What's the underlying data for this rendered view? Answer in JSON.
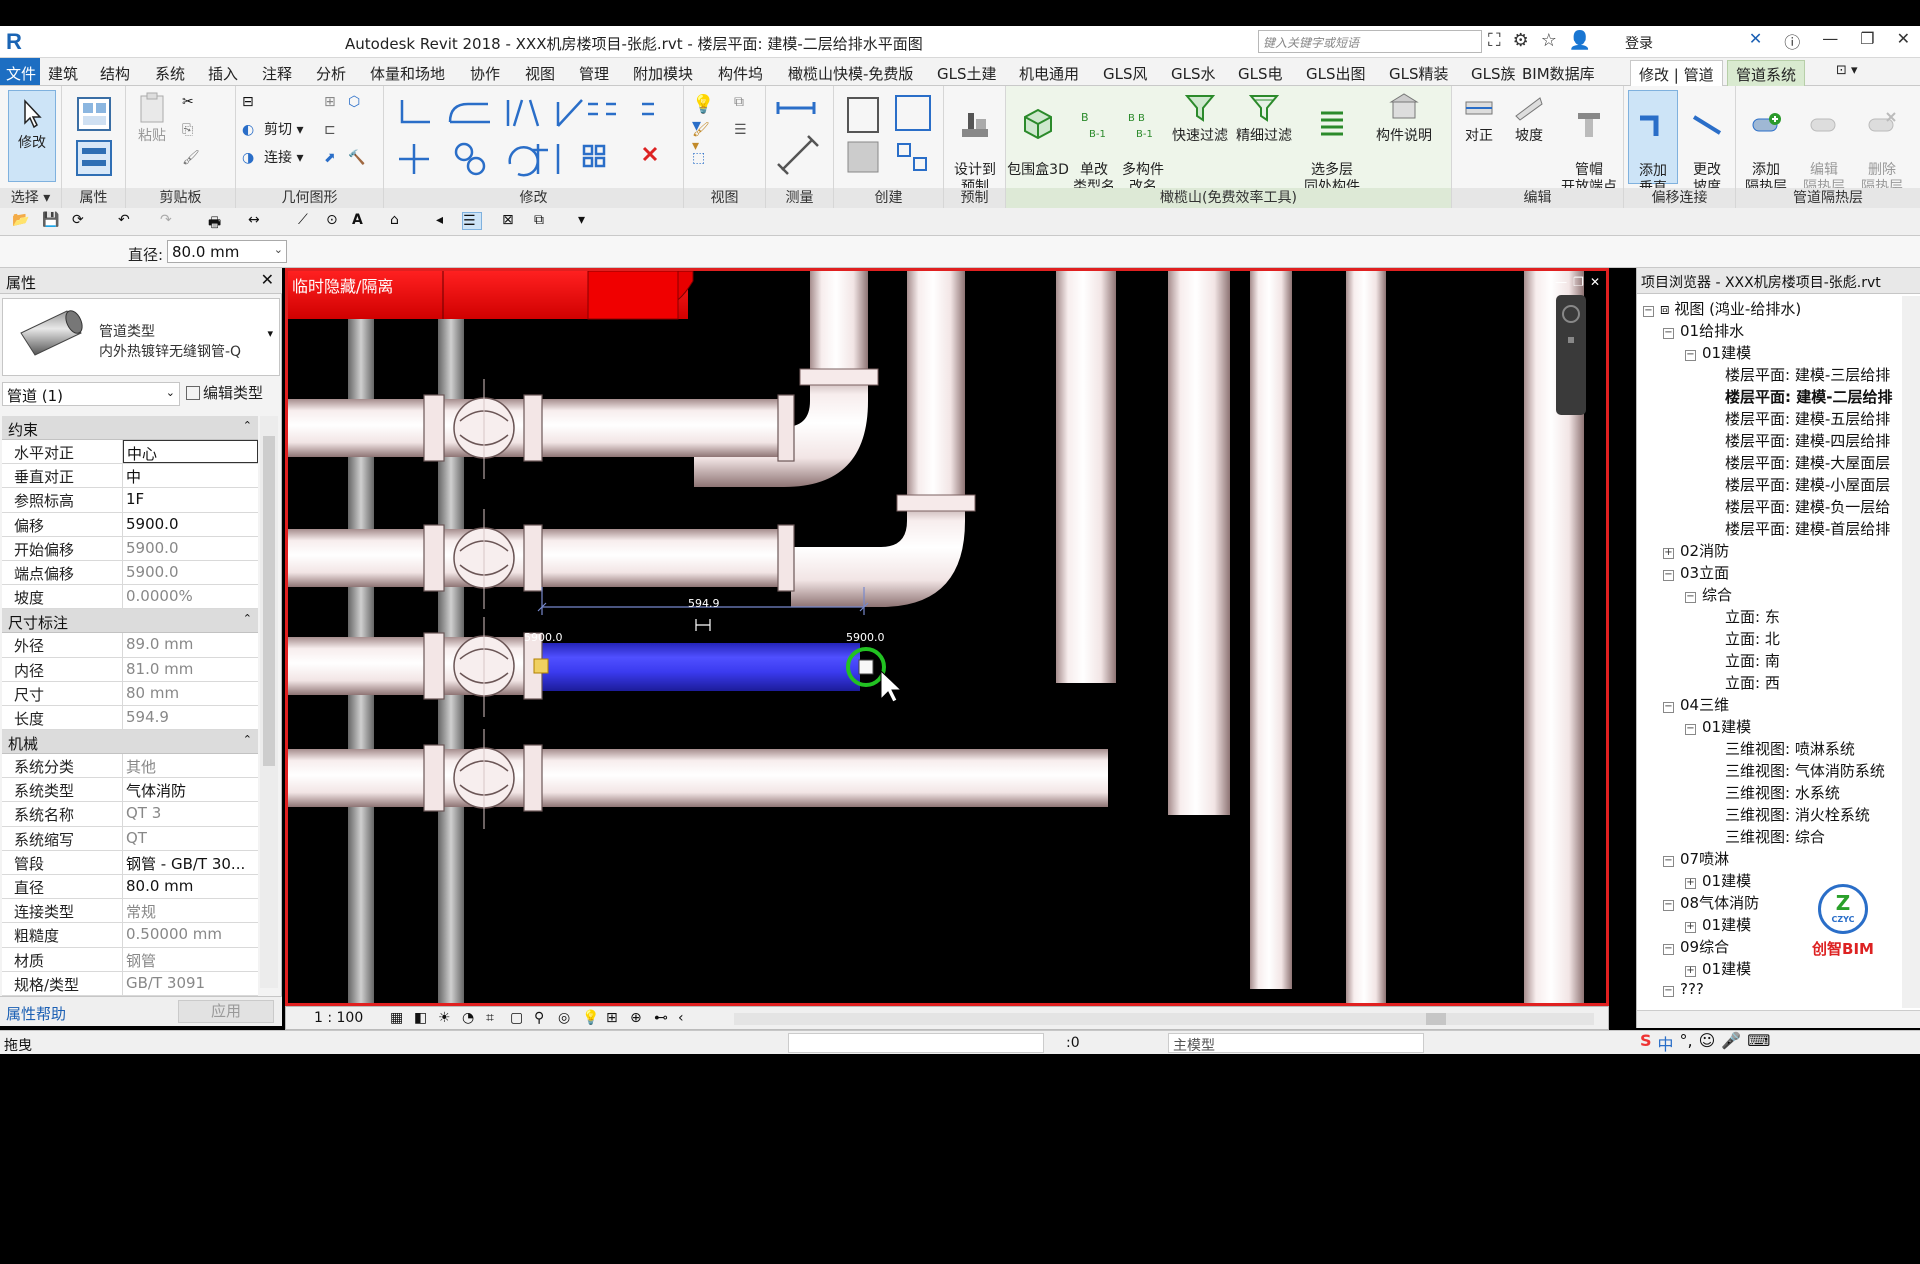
{
  "titlebar": {
    "app_title": "Autodesk Revit 2018 -   XXX机房楼项目-张彪.rvt - 楼层平面: 建模-二层给排水平面图",
    "search_placeholder": "键入关键字或短语",
    "login_label": "登录"
  },
  "menu": {
    "file": "文件",
    "tabs": [
      "建筑",
      "结构",
      "系统",
      "插入",
      "注释",
      "分析",
      "体量和场地",
      "协作",
      "视图",
      "管理",
      "附加模块",
      "构件坞",
      "橄榄山快模-免费版",
      "GLS土建",
      "机电通用",
      "GLS风",
      "GLS水",
      "GLS电",
      "GLS出图",
      "GLS精装",
      "GLS族",
      "BIM数据库"
    ],
    "active_tab": "修改 | 管道",
    "context_tab": "管道系统"
  },
  "ribbon": {
    "select_panel": {
      "modify": "修改",
      "select_label": "选择"
    },
    "properties_panel": {
      "label": "属性"
    },
    "clipboard": {
      "paste": "粘贴",
      "cut": "剪切",
      "join": "连接",
      "label": "剪贴板"
    },
    "geometry": {
      "label": "几何图形"
    },
    "modify": {
      "label": "修改"
    },
    "view": {
      "label": "视图"
    },
    "measure": {
      "label": "测量"
    },
    "create": {
      "label": "创建"
    },
    "prefab": {
      "btn": "设计到\n预制",
      "label": "预制"
    },
    "gls": {
      "buttons": [
        "包围盒3D",
        "单改\n类型名",
        "多构件\n改名",
        "快速过滤",
        "精细过滤",
        "选多层\n同处构件",
        "构件说明"
      ],
      "label": "橄榄山(免费效率工具)"
    },
    "edit": {
      "buttons": [
        "对正",
        "坡度",
        "管帽\n开放端点"
      ],
      "label": "编辑"
    },
    "offset": {
      "buttons": [
        "添加\n垂直",
        "更改\n坡度"
      ],
      "label": "偏移连接"
    },
    "insulation": {
      "buttons": [
        "添加\n隔热层",
        "编辑\n隔热层",
        "删除\n隔热层"
      ],
      "label": "管道隔热层"
    }
  },
  "optbar": {
    "diameter_label": "直径:",
    "diameter_value": "80.0 mm"
  },
  "properties": {
    "header": "属性",
    "type_family": "管道类型",
    "type_name": "内外热镀锌无缝钢管-Q",
    "instance": "管道 (1)",
    "edit_type": "编辑类型",
    "groups": [
      {
        "name": "约束",
        "rows": [
          {
            "k": "水平对正",
            "v": "中心",
            "edit": true
          },
          {
            "k": "垂直对正",
            "v": "中"
          },
          {
            "k": "参照标高",
            "v": "1F"
          },
          {
            "k": "偏移",
            "v": "5900.0"
          },
          {
            "k": "开始偏移",
            "v": "5900.0",
            "ro": true
          },
          {
            "k": "端点偏移",
            "v": "5900.0",
            "ro": true
          },
          {
            "k": "坡度",
            "v": "0.0000%",
            "ro": true
          }
        ]
      },
      {
        "name": "尺寸标注",
        "rows": [
          {
            "k": "外径",
            "v": "89.0 mm",
            "ro": true
          },
          {
            "k": "内径",
            "v": "81.0 mm",
            "ro": true
          },
          {
            "k": "尺寸",
            "v": "80 mm",
            "ro": true
          },
          {
            "k": "长度",
            "v": "594.9",
            "ro": true
          }
        ]
      },
      {
        "name": "机械",
        "rows": [
          {
            "k": "系统分类",
            "v": "其他",
            "ro": true
          },
          {
            "k": "系统类型",
            "v": "气体消防"
          },
          {
            "k": "系统名称",
            "v": "QT 3",
            "ro": true
          },
          {
            "k": "系统缩写",
            "v": "QT",
            "ro": true
          },
          {
            "k": "管段",
            "v": "钢管 - GB/T 30..."
          },
          {
            "k": "直径",
            "v": "80.0 mm"
          },
          {
            "k": "连接类型",
            "v": "常规",
            "ro": true
          },
          {
            "k": "粗糙度",
            "v": "0.50000 mm",
            "ro": true
          },
          {
            "k": "材质",
            "v": "钢管",
            "ro": true
          },
          {
            "k": "规格/类型",
            "v": "GB/T 3091",
            "ro": true
          }
        ]
      }
    ],
    "help": "属性帮助",
    "apply": "应用"
  },
  "viewport": {
    "hide_label": "临时隐藏/隔离",
    "dimension": "594.9",
    "start_offset": "5900.0",
    "end_offset": "5900.0",
    "scale": "1 : 100",
    "colors": {
      "border": "#e02020",
      "pipe_selected": "#3b3bf0",
      "pipe": "#f3e9e9"
    }
  },
  "browser": {
    "header": "项目浏览器 - XXX机房楼项目-张彪.rvt",
    "nodes": [
      {
        "t": "视图 (鸿业-给排水)",
        "lvl": 0,
        "tg": "−",
        "icon": true
      },
      {
        "t": "01给排水",
        "lvl": 1,
        "tg": "−"
      },
      {
        "t": "01建模",
        "lvl": 2,
        "tg": "−"
      },
      {
        "t": "楼层平面: 建模-三层给排",
        "lvl": 3
      },
      {
        "t": "楼层平面: 建模-二层给排",
        "lvl": 3,
        "bold": true
      },
      {
        "t": "楼层平面: 建模-五层给排",
        "lvl": 3
      },
      {
        "t": "楼层平面: 建模-四层给排",
        "lvl": 3
      },
      {
        "t": "楼层平面: 建模-大屋面层",
        "lvl": 3
      },
      {
        "t": "楼层平面: 建模-小屋面层",
        "lvl": 3
      },
      {
        "t": "楼层平面: 建模-负一层给",
        "lvl": 3
      },
      {
        "t": "楼层平面: 建模-首层给排",
        "lvl": 3
      },
      {
        "t": "02消防",
        "lvl": 1,
        "tg": "+"
      },
      {
        "t": "03立面",
        "lvl": 1,
        "tg": "−"
      },
      {
        "t": "综合",
        "lvl": 2,
        "tg": "−"
      },
      {
        "t": "立面: 东",
        "lvl": 3
      },
      {
        "t": "立面: 北",
        "lvl": 3
      },
      {
        "t": "立面: 南",
        "lvl": 3
      },
      {
        "t": "立面: 西",
        "lvl": 3
      },
      {
        "t": "04三维",
        "lvl": 1,
        "tg": "−"
      },
      {
        "t": "01建模",
        "lvl": 2,
        "tg": "−"
      },
      {
        "t": "三维视图: 喷淋系统",
        "lvl": 3
      },
      {
        "t": "三维视图: 气体消防系统",
        "lvl": 3
      },
      {
        "t": "三维视图: 水系统",
        "lvl": 3
      },
      {
        "t": "三维视图: 消火栓系统",
        "lvl": 3
      },
      {
        "t": "三维视图: 综合",
        "lvl": 3
      },
      {
        "t": "07喷淋",
        "lvl": 1,
        "tg": "−"
      },
      {
        "t": "01建模",
        "lvl": 2,
        "tg": "+"
      },
      {
        "t": "08气体消防",
        "lvl": 1,
        "tg": "−"
      },
      {
        "t": "01建模",
        "lvl": 2,
        "tg": "+"
      },
      {
        "t": "09综合",
        "lvl": 1,
        "tg": "−"
      },
      {
        "t": "01建模",
        "lvl": 2,
        "tg": "+"
      },
      {
        "t": "???",
        "lvl": 1,
        "tg": "−"
      }
    ],
    "brand": "创智BIM",
    "brand_logo_text": "CZYC"
  },
  "statusbar": {
    "message": "拖曳",
    "zero": ":0",
    "model": "主模型"
  }
}
